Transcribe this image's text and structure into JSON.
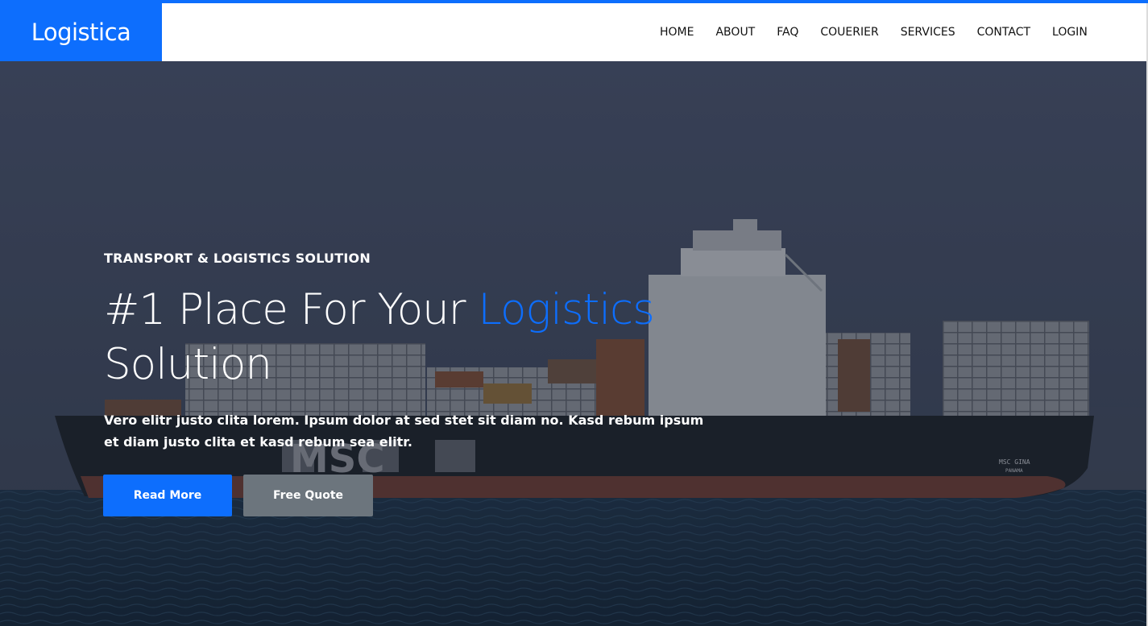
{
  "brand": {
    "name": "Logistica"
  },
  "nav": {
    "items": [
      {
        "label": "HOME"
      },
      {
        "label": "ABOUT"
      },
      {
        "label": "FAQ"
      },
      {
        "label": "COUERIER"
      },
      {
        "label": "SERVICES"
      },
      {
        "label": "CONTACT"
      },
      {
        "label": "LOGIN"
      }
    ]
  },
  "hero": {
    "eyebrow": "TRANSPORT & LOGISTICS SOLUTION",
    "headline_part1": "#1 Place For Your ",
    "headline_accent": "Logistics",
    "headline_part2": "Solution",
    "lede": "Vero elitr justo clita lorem. Ipsum dolor at sed stet sit diam no. Kasd rebum ipsum et diam justo clita et kasd rebum sea elitr.",
    "primary_button": "Read More",
    "secondary_button": "Free Quote",
    "ship_hull_text": "MSC",
    "ship_name": "MSC GINA",
    "ship_port": "PANAMA"
  },
  "colors": {
    "accent": "#0d6efd",
    "secondary": "#6c757d",
    "header_bg": "#ffffff"
  }
}
